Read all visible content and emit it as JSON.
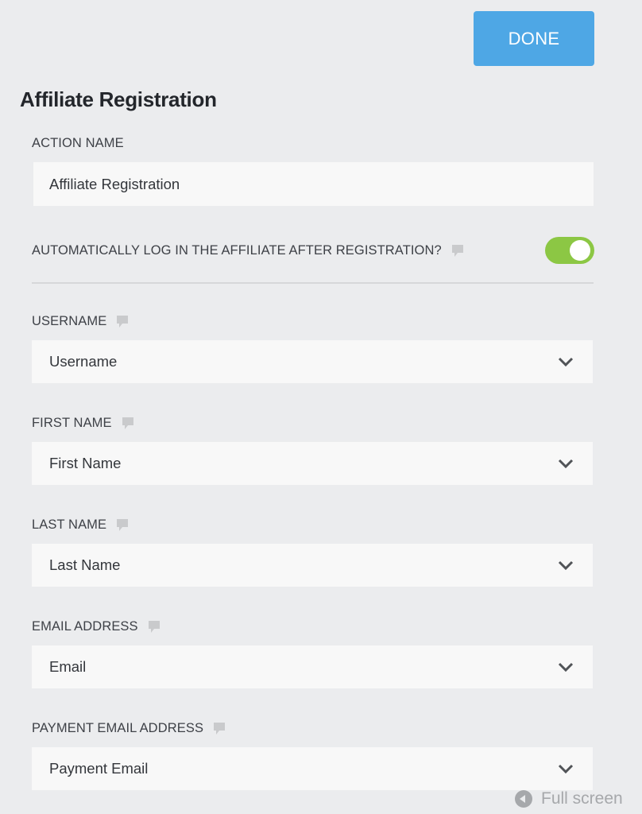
{
  "header": {
    "done_label": "DONE"
  },
  "page": {
    "title": "Affiliate Registration"
  },
  "action_name": {
    "label": "ACTION NAME",
    "value": "Affiliate Registration"
  },
  "auto_login": {
    "label": "AUTOMATICALLY LOG IN THE AFFILIATE AFTER REGISTRATION?",
    "enabled": true,
    "color": "#8cc744"
  },
  "fields": [
    {
      "label": "USERNAME",
      "value": "Username"
    },
    {
      "label": "FIRST NAME",
      "value": "First Name"
    },
    {
      "label": "LAST NAME",
      "value": "Last Name"
    },
    {
      "label": "EMAIL ADDRESS",
      "value": "Email"
    },
    {
      "label": "PAYMENT EMAIL ADDRESS",
      "value": "Payment Email"
    }
  ],
  "footer": {
    "fullscreen_label": "Full screen"
  },
  "colors": {
    "accent": "#4ea7e5",
    "background": "#ebecee",
    "field": "#f8f8f8"
  }
}
